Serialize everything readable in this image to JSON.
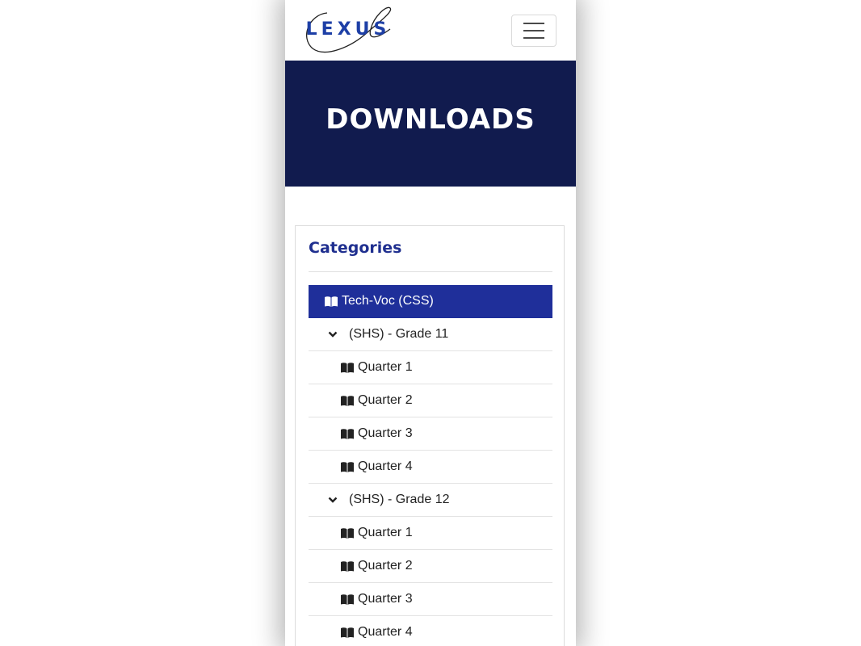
{
  "header": {
    "logo_text": "LEXUS",
    "brand_color": "#1d3fa6"
  },
  "hero": {
    "title": "DOWNLOADS",
    "background": "#111b4e"
  },
  "categories": {
    "title": "Categories",
    "active_color": "#1f2f9a",
    "items": [
      {
        "type": "category",
        "icon": "book-open-icon",
        "label": "Tech-Voc (CSS)",
        "active": true
      },
      {
        "type": "grade",
        "icon": "chevron-down-icon",
        "label": "(SHS) - Grade 11"
      },
      {
        "type": "quarter",
        "icon": "book-open-icon",
        "label": "Quarter 1"
      },
      {
        "type": "quarter",
        "icon": "book-open-icon",
        "label": "Quarter 2"
      },
      {
        "type": "quarter",
        "icon": "book-open-icon",
        "label": "Quarter 3"
      },
      {
        "type": "quarter",
        "icon": "book-open-icon",
        "label": "Quarter 4"
      },
      {
        "type": "grade",
        "icon": "chevron-down-icon",
        "label": "(SHS) - Grade 12"
      },
      {
        "type": "quarter",
        "icon": "book-open-icon",
        "label": "Quarter 1"
      },
      {
        "type": "quarter",
        "icon": "book-open-icon",
        "label": "Quarter 2"
      },
      {
        "type": "quarter",
        "icon": "book-open-icon",
        "label": "Quarter 3"
      },
      {
        "type": "quarter",
        "icon": "book-open-icon",
        "label": "Quarter 4"
      }
    ]
  }
}
